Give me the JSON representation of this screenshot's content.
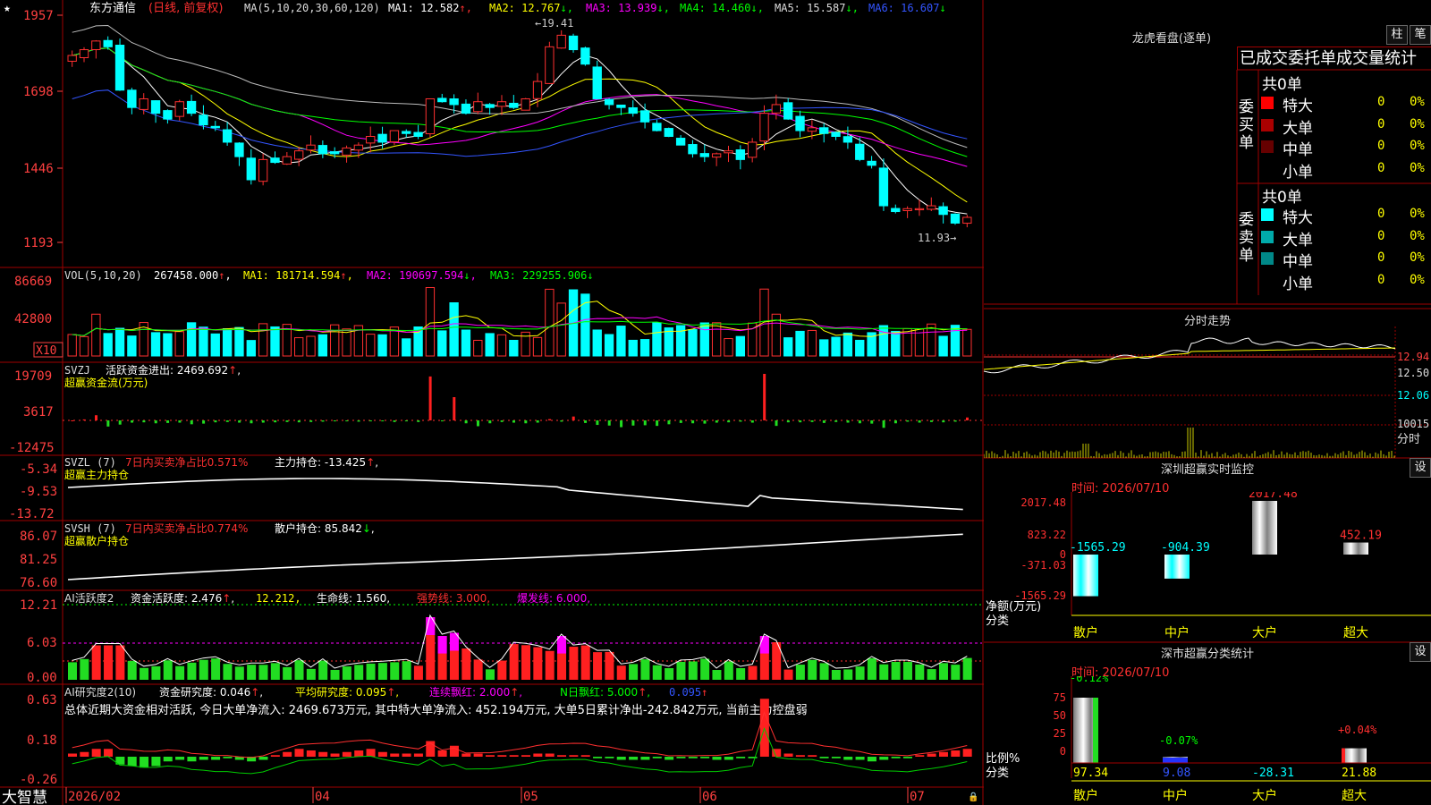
{
  "header": {
    "star": "★",
    "stock_name": "东方通信",
    "period": "(日线, 前复权)",
    "ma_label": "MA(5,10,20,30,60,120)",
    "ma_values": [
      {
        "label": "MA1: 12.582",
        "arrow": "↑",
        "color": "#ffffff"
      },
      {
        "label": "MA2: 12.767",
        "arrow": "↓",
        "color": "#ffff00"
      },
      {
        "label": "MA3: 13.939",
        "arrow": "↓",
        "color": "#ff00ff"
      },
      {
        "label": "MA4: 14.460",
        "arrow": "↓",
        "color": "#00ff00"
      },
      {
        "label": "MA5: 15.587",
        "arrow": "↓",
        "color": "#dddddd"
      },
      {
        "label": "MA6: 16.607",
        "arrow": "↓",
        "color": "#3355ff"
      }
    ]
  },
  "price_axis": [
    "1957",
    "1698",
    "1446",
    "1193"
  ],
  "price_annotations": {
    "high": "19.41",
    "low": "11.93"
  },
  "vol_panel": {
    "title": "VOL(5,10,20)",
    "value": "267458.000",
    "ma": [
      {
        "label": "MA1: 181714.594",
        "color": "#ffff00"
      },
      {
        "label": "MA2: 190697.594",
        "color": "#ff00ff"
      },
      {
        "label": "MA3: 229255.906",
        "color": "#00ff00"
      }
    ],
    "axis": [
      "86669",
      "42800"
    ],
    "unit": "X10"
  },
  "svzj_panel": {
    "title": "SVZJ",
    "label": "活跃资金进出: 2469.692",
    "sub": "超赢资金流(万元)",
    "axis": [
      "19709",
      "3617",
      "-12475"
    ]
  },
  "svzl_panel": {
    "title": "SVZL (7)",
    "pct": "7日内买卖净占比0.571%",
    "hold": "主力持仓: -13.425",
    "sub": "超赢主力持仓",
    "axis": [
      "-5.34",
      "-9.53",
      "-13.72"
    ]
  },
  "svsh_panel": {
    "title": "SVSH (7)",
    "pct": "7日内买卖净占比0.774%",
    "hold": "散户持仓: 85.842",
    "sub": "超赢散户持仓",
    "axis": [
      "86.07",
      "81.25",
      "76.60"
    ]
  },
  "ai_active": {
    "title": "AI活跃度2",
    "a": "资金活跃度: 2.476",
    "b": "12.212",
    "c": "生命线: 1.560",
    "d": "强势线: 3.000",
    "e": "爆发线: 6.000",
    "axis": [
      "12.21",
      "6.03",
      "0.00"
    ]
  },
  "ai_research": {
    "title": "AI研究度2(10)",
    "a": "资金研究度: 0.046",
    "b": "平均研究度: 0.095",
    "c": "连续飘红: 2.000",
    "d": "N日飘红: 5.000",
    "e": "0.095",
    "summary": "总体近期大资金相对活跃, 今日大单净流入: 2469.673万元, 其中特大单净流入: 452.194万元, 大单5日累计净出-242.842万元, 当前主力控盘弱",
    "axis": [
      "0.63",
      "0.18",
      "-0.26"
    ]
  },
  "date_axis": [
    "2026/02",
    "04",
    "05",
    "06",
    "07"
  ],
  "brand": "大智慧",
  "chart_data": {
    "type": "candlestick",
    "title": "东方通信",
    "ylim": [
      11.5,
      19.7
    ],
    "high_label": 19.41,
    "low_label": 11.93,
    "price_path": [
      18.4,
      18.6,
      18.9,
      18.7,
      17.2,
      16.6,
      16.9,
      16.4,
      16.2,
      16.8,
      16.4,
      16.0,
      15.9,
      15.4,
      14.9,
      14.1,
      14.8,
      14.7,
      14.9,
      15.1,
      15.3,
      15.0,
      15.0,
      15.2,
      15.3,
      15.6,
      15.4,
      15.8,
      15.7,
      15.6,
      16.9,
      16.8,
      16.7,
      16.4,
      16.8,
      16.6,
      16.8,
      16.6,
      16.9,
      17.5,
      18.7,
      19.1,
      18.6,
      18.1,
      16.9,
      16.7,
      16.6,
      16.4,
      16.1,
      15.8,
      15.6,
      15.3,
      15.0,
      14.9,
      15.0,
      15.1,
      14.8,
      15.4,
      16.4,
      16.7,
      16.2,
      15.8,
      15.9,
      15.7,
      15.6,
      15.4,
      14.8,
      14.6,
      13.2,
      13.0,
      13.1,
      13.1,
      13.2,
      12.9,
      12.6,
      12.8
    ],
    "svzj": [
      0,
      300,
      1600,
      -1900,
      -1300,
      -700,
      -600,
      -900,
      -800,
      -700,
      -1200,
      -1000,
      -600,
      -500,
      -700,
      -900,
      -700,
      -600,
      -500,
      -600,
      -500,
      -400,
      -300,
      -300,
      -400,
      -300,
      -300,
      -500,
      -300,
      -500,
      13600,
      -300,
      7200,
      -900,
      -1800,
      -900,
      -500,
      -700,
      -900,
      -700,
      400,
      -400,
      1200,
      -800,
      -1400,
      -1600,
      -2100,
      -1600,
      -1500,
      -1700,
      -1200,
      -800,
      -900,
      -1000,
      -700,
      -600,
      -400,
      -700,
      14400,
      -1700,
      -600,
      -600,
      -500,
      -800,
      -500,
      -700,
      -900,
      -1000,
      -2300,
      -900,
      -400,
      -700,
      -500,
      -600,
      -400,
      900
    ],
    "ai_research": [
      0.02,
      0.03,
      0.05,
      0.05,
      -0.05,
      -0.06,
      -0.07,
      -0.06,
      -0.03,
      -0.02,
      -0.03,
      -0.02,
      -0.02,
      -0.01,
      -0.02,
      -0.03,
      -0.02,
      0.01,
      0.03,
      0.05,
      0.04,
      0.03,
      0.02,
      0.03,
      0.04,
      0.05,
      0.03,
      0.02,
      0.02,
      0.02,
      0.1,
      0.04,
      0.07,
      0.02,
      0.02,
      0.01,
      0.01,
      0.01,
      0.01,
      0.02,
      0.02,
      0.01,
      0.01,
      0.01,
      -0.01,
      -0.01,
      -0.02,
      -0.02,
      -0.02,
      -0.01,
      -0.02,
      -0.01,
      -0.01,
      -0.01,
      -0.02,
      -0.02,
      -0.01,
      -0.01,
      0.37,
      0.05,
      0.02,
      0.01,
      0.01,
      -0.01,
      -0.01,
      -0.02,
      -0.02,
      -0.03,
      -0.02,
      -0.01,
      -0.01,
      0.01,
      0.02,
      0.03,
      0.04,
      0.05
    ]
  },
  "right": {
    "dragon_title": "龙虎看盘(逐单)",
    "btn_bar": "柱",
    "btn_stroke": "笔",
    "tabs": "已成交委托单成交量统计",
    "buy": {
      "side_label": "委买单",
      "total": "共0单",
      "rows": [
        {
          "label": "特大",
          "count": "0",
          "pct": "0%",
          "color": "#ff0000"
        },
        {
          "label": "大单",
          "count": "0",
          "pct": "0%",
          "color": "#aa0000"
        },
        {
          "label": "中单",
          "count": "0",
          "pct": "0%",
          "color": "#660000"
        },
        {
          "label": "小单",
          "count": "0",
          "pct": "0%",
          "color": ""
        }
      ]
    },
    "sell": {
      "side_label": "委卖单",
      "total": "共0单",
      "rows": [
        {
          "label": "特大",
          "count": "0",
          "pct": "0%",
          "color": "#00ffff"
        },
        {
          "label": "大单",
          "count": "0",
          "pct": "0%",
          "color": "#00aaaa"
        },
        {
          "label": "中单",
          "count": "0",
          "pct": "0%",
          "color": "#008888"
        },
        {
          "label": "小单",
          "count": "0",
          "pct": "0%",
          "color": ""
        }
      ]
    },
    "intraday": {
      "title": "分时走势",
      "axis": [
        "12.94",
        "12.50",
        "12.06"
      ],
      "vol_axis": "10015",
      "vol_unit": "分时"
    },
    "sz_monitor": {
      "title": "深圳超赢实时监控",
      "btn": "设",
      "time": "时间: 2026/07/10",
      "axis": [
        "2017.48",
        "823.22",
        "0",
        "-371.03",
        "-1565.29"
      ],
      "row_label": "净额(万元)",
      "cat_label": "分类",
      "bars": [
        {
          "name": "散户",
          "value": -1565.29,
          "label": "-1565.29"
        },
        {
          "name": "中户",
          "value": -904.39,
          "label": "-904.39"
        },
        {
          "name": "大户",
          "value": 2017.48,
          "label": "2017.48"
        },
        {
          "name": "超大",
          "value": 452.19,
          "label": "452.19"
        }
      ]
    },
    "sz_class": {
      "title": "深市超赢分类统计",
      "btn": "设",
      "time": "时间: 2026/07/10",
      "axis": [
        "75",
        "50",
        "25",
        "0"
      ],
      "row_label": "比例%",
      "cat_label": "分类",
      "bars": [
        {
          "name": "散户",
          "value": 97.34,
          "label": "97.34",
          "delta": "-0.12%"
        },
        {
          "name": "中户",
          "value": 9.08,
          "label": "9.08",
          "delta": "-0.07%"
        },
        {
          "name": "大户",
          "value": -28.31,
          "label": "-28.31",
          "delta": ""
        },
        {
          "name": "超大",
          "value": 21.88,
          "label": "21.88",
          "delta": "+0.04%"
        }
      ]
    }
  }
}
